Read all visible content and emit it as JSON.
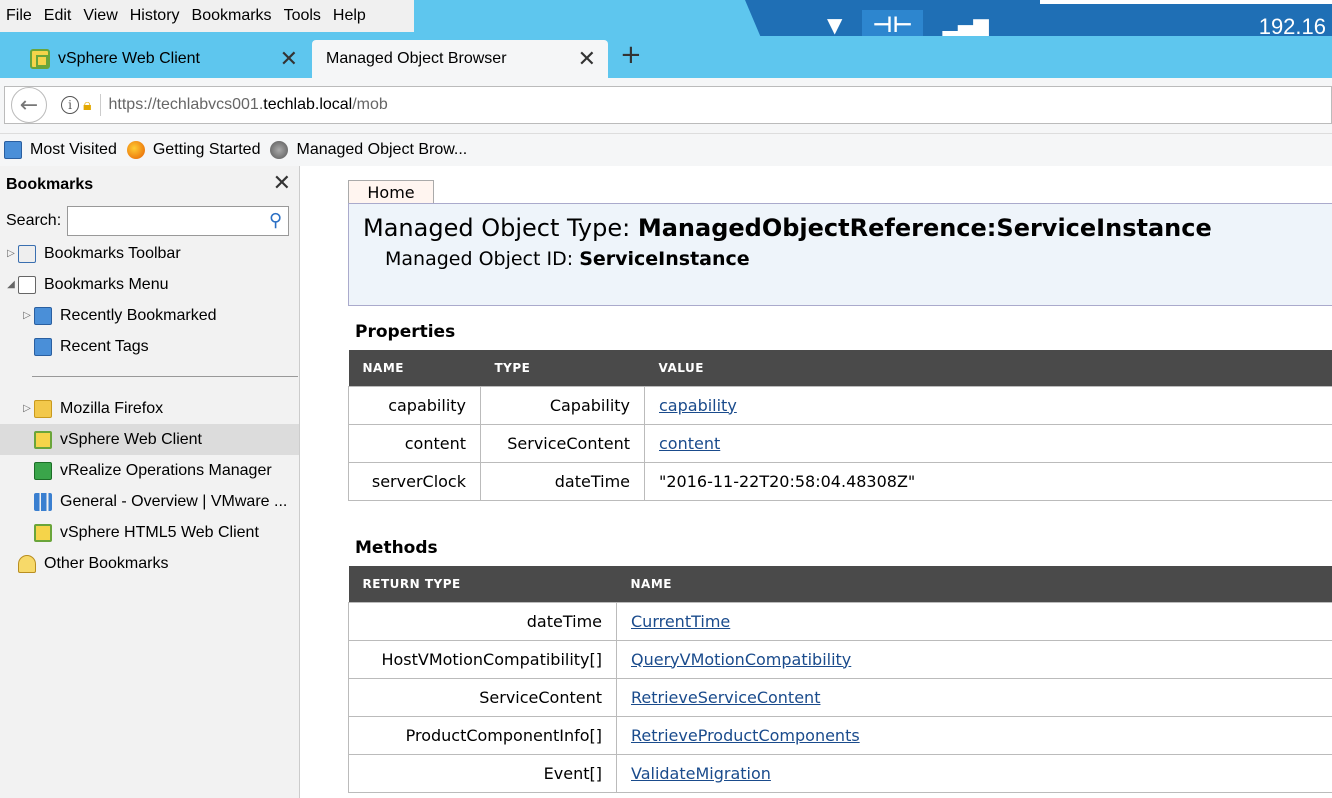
{
  "menubar": {
    "items": [
      {
        "label": "File"
      },
      {
        "label": "Edit"
      },
      {
        "label": "View"
      },
      {
        "label": "History"
      },
      {
        "label": "Bookmarks"
      },
      {
        "label": "Tools"
      },
      {
        "label": "Help"
      }
    ]
  },
  "remote": {
    "ip_partial": "192.16"
  },
  "tabs": [
    {
      "label": "vSphere Web Client"
    },
    {
      "label": "Managed Object Browser"
    }
  ],
  "navbar": {
    "url_prefix": "https://techlabvcs001.",
    "url_domain": "techlab.local",
    "url_path": "/mob"
  },
  "bookmarks_toolbar": [
    {
      "label": "Most Visited",
      "icon": "bookmark-icon"
    },
    {
      "label": "Getting Started",
      "icon": "firefox-icon"
    },
    {
      "label": "Managed Object Brow...",
      "icon": "globe-icon"
    }
  ],
  "sidebar": {
    "title": "Bookmarks",
    "search_label": "Search:",
    "tree": [
      {
        "label": "Bookmarks Toolbar"
      },
      {
        "label": "Bookmarks Menu"
      },
      {
        "label": "Recently Bookmarked"
      },
      {
        "label": "Recent Tags"
      },
      {
        "label": "Mozilla Firefox"
      },
      {
        "label": "vSphere Web Client"
      },
      {
        "label": "vRealize Operations Manager"
      },
      {
        "label": "General - Overview | VMware ..."
      },
      {
        "label": "vSphere HTML5 Web Client"
      },
      {
        "label": "Other Bookmarks"
      }
    ]
  },
  "main": {
    "home": "Home",
    "mo_type_label": "Managed Object Type:",
    "mo_type_value": "ManagedObjectReference:ServiceInstance",
    "mo_id_label": "Managed Object ID:",
    "mo_id_value": "ServiceInstance",
    "properties": {
      "title": "Properties",
      "headers": [
        "NAME",
        "TYPE",
        "VALUE"
      ],
      "rows": [
        {
          "name": "capability",
          "type": "Capability",
          "value": "capability"
        },
        {
          "name": "content",
          "type": "ServiceContent",
          "value": "content"
        },
        {
          "name": "serverClock",
          "type": "dateTime",
          "value": "\"2016-11-22T20:58:04.48308Z\""
        }
      ]
    },
    "methods": {
      "title": "Methods",
      "headers": [
        "RETURN TYPE",
        "NAME"
      ],
      "rows": [
        {
          "return_type": "dateTime",
          "name": "CurrentTime"
        },
        {
          "return_type": "HostVMotionCompatibility[]",
          "name": "QueryVMotionCompatibility"
        },
        {
          "return_type": "ServiceContent",
          "name": "RetrieveServiceContent"
        },
        {
          "return_type": "ProductComponentInfo[]",
          "name": "RetrieveProductComponents"
        },
        {
          "return_type": "Event[]",
          "name": "ValidateMigration"
        }
      ]
    }
  }
}
